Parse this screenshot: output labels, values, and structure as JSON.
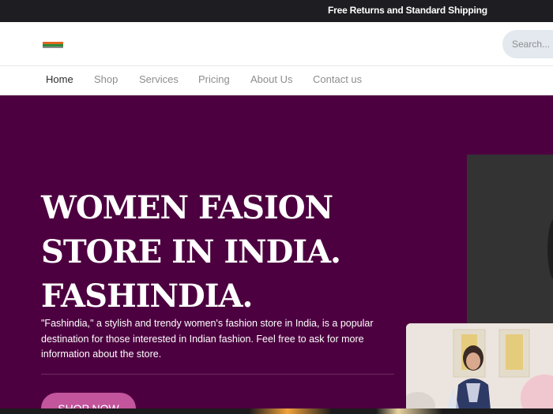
{
  "topbar": {
    "text": "Free Returns and Standard Shipping"
  },
  "header": {
    "search_placeholder": "Search..."
  },
  "nav": {
    "items": [
      "Home",
      "Shop",
      "Services",
      "Pricing",
      "About Us",
      "Contact us"
    ],
    "active": "Home"
  },
  "hero": {
    "title_lines": [
      "WOMEN FASION",
      "STORE IN INDIA.",
      "FASHINDIA."
    ],
    "description": "\"Fashindia,\" a stylish and trendy women's fashion store in India, is a popular destination for those interested in Indian fashion. Feel free to ask for more information about the store.",
    "button_label": "SHOP NOW"
  },
  "colors": {
    "topbar": "#1e1d21",
    "hero_bg": "#4d0040",
    "button": "#c2559c",
    "search_bg": "#e3e9ee"
  }
}
